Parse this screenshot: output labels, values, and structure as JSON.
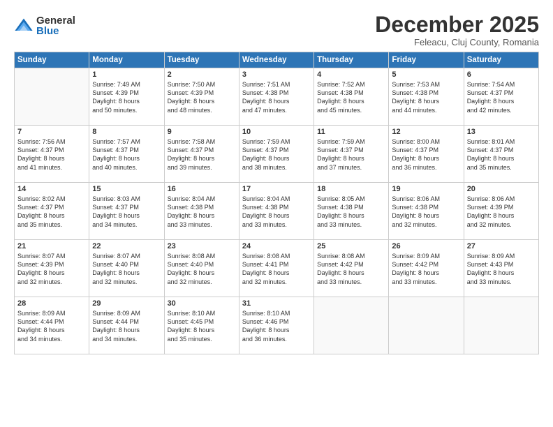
{
  "logo": {
    "general": "General",
    "blue": "Blue"
  },
  "title": "December 2025",
  "location": "Feleacu, Cluj County, Romania",
  "days_of_week": [
    "Sunday",
    "Monday",
    "Tuesday",
    "Wednesday",
    "Thursday",
    "Friday",
    "Saturday"
  ],
  "weeks": [
    [
      {
        "day": "",
        "sunrise": "",
        "sunset": "",
        "daylight": ""
      },
      {
        "day": "1",
        "sunrise": "Sunrise: 7:49 AM",
        "sunset": "Sunset: 4:39 PM",
        "daylight": "Daylight: 8 hours and 50 minutes."
      },
      {
        "day": "2",
        "sunrise": "Sunrise: 7:50 AM",
        "sunset": "Sunset: 4:39 PM",
        "daylight": "Daylight: 8 hours and 48 minutes."
      },
      {
        "day": "3",
        "sunrise": "Sunrise: 7:51 AM",
        "sunset": "Sunset: 4:38 PM",
        "daylight": "Daylight: 8 hours and 47 minutes."
      },
      {
        "day": "4",
        "sunrise": "Sunrise: 7:52 AM",
        "sunset": "Sunset: 4:38 PM",
        "daylight": "Daylight: 8 hours and 45 minutes."
      },
      {
        "day": "5",
        "sunrise": "Sunrise: 7:53 AM",
        "sunset": "Sunset: 4:38 PM",
        "daylight": "Daylight: 8 hours and 44 minutes."
      },
      {
        "day": "6",
        "sunrise": "Sunrise: 7:54 AM",
        "sunset": "Sunset: 4:37 PM",
        "daylight": "Daylight: 8 hours and 42 minutes."
      }
    ],
    [
      {
        "day": "7",
        "sunrise": "Sunrise: 7:56 AM",
        "sunset": "Sunset: 4:37 PM",
        "daylight": "Daylight: 8 hours and 41 minutes."
      },
      {
        "day": "8",
        "sunrise": "Sunrise: 7:57 AM",
        "sunset": "Sunset: 4:37 PM",
        "daylight": "Daylight: 8 hours and 40 minutes."
      },
      {
        "day": "9",
        "sunrise": "Sunrise: 7:58 AM",
        "sunset": "Sunset: 4:37 PM",
        "daylight": "Daylight: 8 hours and 39 minutes."
      },
      {
        "day": "10",
        "sunrise": "Sunrise: 7:59 AM",
        "sunset": "Sunset: 4:37 PM",
        "daylight": "Daylight: 8 hours and 38 minutes."
      },
      {
        "day": "11",
        "sunrise": "Sunrise: 7:59 AM",
        "sunset": "Sunset: 4:37 PM",
        "daylight": "Daylight: 8 hours and 37 minutes."
      },
      {
        "day": "12",
        "sunrise": "Sunrise: 8:00 AM",
        "sunset": "Sunset: 4:37 PM",
        "daylight": "Daylight: 8 hours and 36 minutes."
      },
      {
        "day": "13",
        "sunrise": "Sunrise: 8:01 AM",
        "sunset": "Sunset: 4:37 PM",
        "daylight": "Daylight: 8 hours and 35 minutes."
      }
    ],
    [
      {
        "day": "14",
        "sunrise": "Sunrise: 8:02 AM",
        "sunset": "Sunset: 4:37 PM",
        "daylight": "Daylight: 8 hours and 35 minutes."
      },
      {
        "day": "15",
        "sunrise": "Sunrise: 8:03 AM",
        "sunset": "Sunset: 4:37 PM",
        "daylight": "Daylight: 8 hours and 34 minutes."
      },
      {
        "day": "16",
        "sunrise": "Sunrise: 8:04 AM",
        "sunset": "Sunset: 4:38 PM",
        "daylight": "Daylight: 8 hours and 33 minutes."
      },
      {
        "day": "17",
        "sunrise": "Sunrise: 8:04 AM",
        "sunset": "Sunset: 4:38 PM",
        "daylight": "Daylight: 8 hours and 33 minutes."
      },
      {
        "day": "18",
        "sunrise": "Sunrise: 8:05 AM",
        "sunset": "Sunset: 4:38 PM",
        "daylight": "Daylight: 8 hours and 33 minutes."
      },
      {
        "day": "19",
        "sunrise": "Sunrise: 8:06 AM",
        "sunset": "Sunset: 4:38 PM",
        "daylight": "Daylight: 8 hours and 32 minutes."
      },
      {
        "day": "20",
        "sunrise": "Sunrise: 8:06 AM",
        "sunset": "Sunset: 4:39 PM",
        "daylight": "Daylight: 8 hours and 32 minutes."
      }
    ],
    [
      {
        "day": "21",
        "sunrise": "Sunrise: 8:07 AM",
        "sunset": "Sunset: 4:39 PM",
        "daylight": "Daylight: 8 hours and 32 minutes."
      },
      {
        "day": "22",
        "sunrise": "Sunrise: 8:07 AM",
        "sunset": "Sunset: 4:40 PM",
        "daylight": "Daylight: 8 hours and 32 minutes."
      },
      {
        "day": "23",
        "sunrise": "Sunrise: 8:08 AM",
        "sunset": "Sunset: 4:40 PM",
        "daylight": "Daylight: 8 hours and 32 minutes."
      },
      {
        "day": "24",
        "sunrise": "Sunrise: 8:08 AM",
        "sunset": "Sunset: 4:41 PM",
        "daylight": "Daylight: 8 hours and 32 minutes."
      },
      {
        "day": "25",
        "sunrise": "Sunrise: 8:08 AM",
        "sunset": "Sunset: 4:42 PM",
        "daylight": "Daylight: 8 hours and 33 minutes."
      },
      {
        "day": "26",
        "sunrise": "Sunrise: 8:09 AM",
        "sunset": "Sunset: 4:42 PM",
        "daylight": "Daylight: 8 hours and 33 minutes."
      },
      {
        "day": "27",
        "sunrise": "Sunrise: 8:09 AM",
        "sunset": "Sunset: 4:43 PM",
        "daylight": "Daylight: 8 hours and 33 minutes."
      }
    ],
    [
      {
        "day": "28",
        "sunrise": "Sunrise: 8:09 AM",
        "sunset": "Sunset: 4:44 PM",
        "daylight": "Daylight: 8 hours and 34 minutes."
      },
      {
        "day": "29",
        "sunrise": "Sunrise: 8:09 AM",
        "sunset": "Sunset: 4:44 PM",
        "daylight": "Daylight: 8 hours and 34 minutes."
      },
      {
        "day": "30",
        "sunrise": "Sunrise: 8:10 AM",
        "sunset": "Sunset: 4:45 PM",
        "daylight": "Daylight: 8 hours and 35 minutes."
      },
      {
        "day": "31",
        "sunrise": "Sunrise: 8:10 AM",
        "sunset": "Sunset: 4:46 PM",
        "daylight": "Daylight: 8 hours and 36 minutes."
      },
      {
        "day": "",
        "sunrise": "",
        "sunset": "",
        "daylight": ""
      },
      {
        "day": "",
        "sunrise": "",
        "sunset": "",
        "daylight": ""
      },
      {
        "day": "",
        "sunrise": "",
        "sunset": "",
        "daylight": ""
      }
    ]
  ]
}
